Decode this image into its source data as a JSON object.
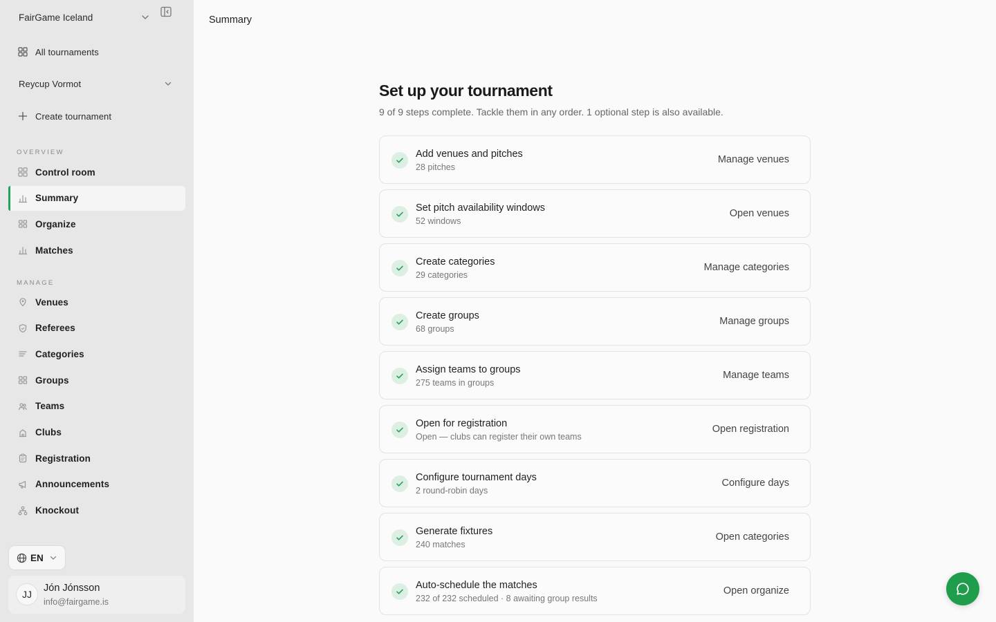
{
  "sidebar": {
    "org_name": "FairGame Iceland",
    "all_tournaments": "All tournaments",
    "tournament_select": "Reycup Vormot",
    "create_tournament": "Create tournament",
    "overview_label": "OVERVIEW",
    "overview_items": [
      {
        "label": "Control room",
        "icon": "dashboard-icon"
      },
      {
        "label": "Summary",
        "icon": "bar-chart-icon",
        "active": true
      },
      {
        "label": "Organize",
        "icon": "grid-icon"
      },
      {
        "label": "Matches",
        "icon": "bar-chart-icon"
      }
    ],
    "manage_label": "MANAGE",
    "manage_items": [
      {
        "label": "Venues",
        "icon": "map-pin-icon"
      },
      {
        "label": "Referees",
        "icon": "shield-icon"
      },
      {
        "label": "Categories",
        "icon": "list-icon"
      },
      {
        "label": "Groups",
        "icon": "grid-icon"
      },
      {
        "label": "Teams",
        "icon": "users-icon"
      },
      {
        "label": "Clubs",
        "icon": "building-icon"
      },
      {
        "label": "Registration",
        "icon": "clipboard-icon"
      },
      {
        "label": "Announcements",
        "icon": "megaphone-icon"
      },
      {
        "label": "Knockout",
        "icon": "bracket-icon"
      }
    ],
    "language": "EN",
    "user": {
      "initials": "JJ",
      "name": "Jón Jónsson",
      "email": "info@fairgame.is"
    }
  },
  "main": {
    "page_title": "Summary",
    "heading": "Set up your tournament",
    "subheading": "9 of 9 steps complete. Tackle them in any order. 1 optional step is also available.",
    "steps": [
      {
        "title": "Add venues and pitches",
        "subtitle": "28 pitches",
        "action": "Manage venues"
      },
      {
        "title": "Set pitch availability windows",
        "subtitle": "52 windows",
        "action": "Open venues"
      },
      {
        "title": "Create categories",
        "subtitle": "29 categories",
        "action": "Manage categories"
      },
      {
        "title": "Create groups",
        "subtitle": "68 groups",
        "action": "Manage groups"
      },
      {
        "title": "Assign teams to groups",
        "subtitle": "275 teams in groups",
        "action": "Manage teams"
      },
      {
        "title": "Open for registration",
        "subtitle": "Open — clubs can register their own teams",
        "action": "Open registration"
      },
      {
        "title": "Configure tournament days",
        "subtitle": "2 round-robin days",
        "action": "Configure days"
      },
      {
        "title": "Generate fixtures",
        "subtitle": "240 matches",
        "action": "Open categories"
      },
      {
        "title": "Auto-schedule the matches",
        "subtitle": "232 of 232 scheduled · 8 awaiting group results",
        "action": "Open organize"
      }
    ]
  },
  "colors": {
    "accent": "#22a35a",
    "check_bg": "#dcefe2",
    "fab": "#1f9d4c"
  }
}
